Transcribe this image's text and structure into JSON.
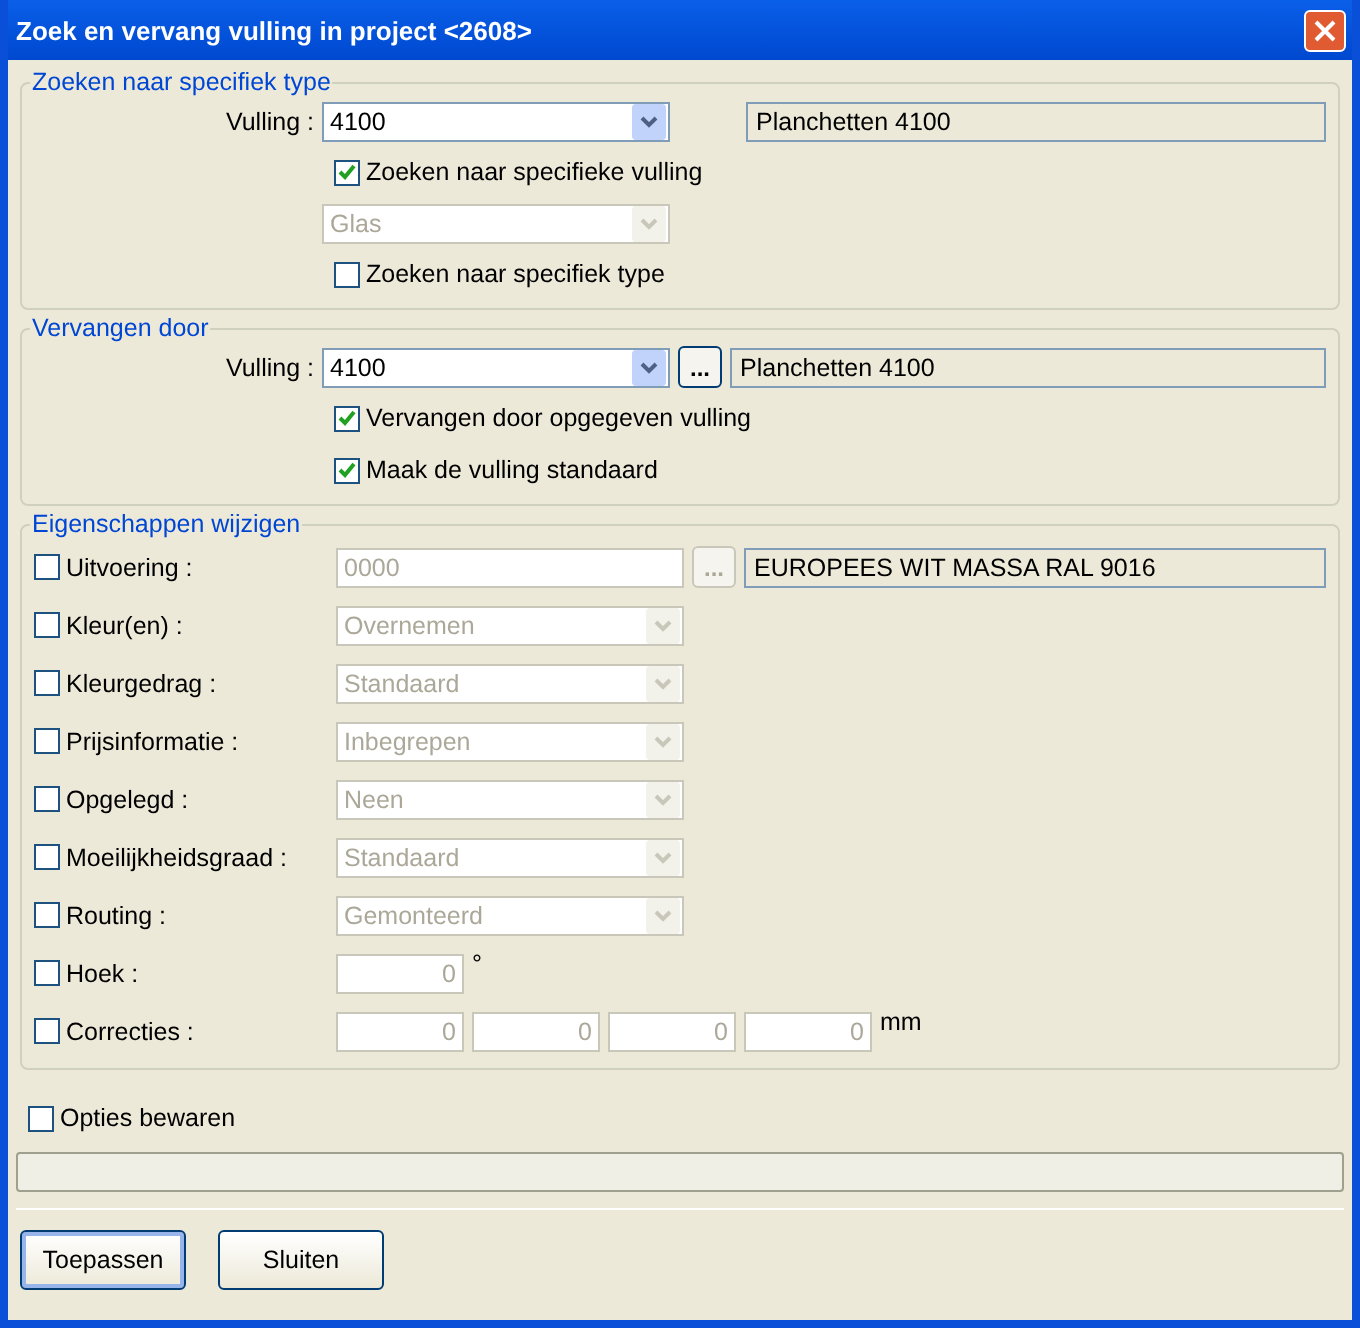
{
  "window": {
    "title": "Zoek en vervang vulling in project <2608>"
  },
  "search": {
    "legend": "Zoeken naar specifiek type",
    "label": "Vulling :",
    "value": "4100",
    "description": "Planchetten 4100",
    "specific_filling": {
      "label": "Zoeken naar specifieke vulling",
      "checked": true
    },
    "type_select": {
      "value": "Glas",
      "disabled": true
    },
    "specific_type": {
      "label": "Zoeken naar specifiek type",
      "checked": false
    }
  },
  "replace": {
    "legend": "Vervangen door",
    "label": "Vulling :",
    "value": "4100",
    "browse": "...",
    "description": "Planchetten 4100",
    "options": [
      {
        "label": "Vervangen door opgegeven vulling",
        "checked": true
      },
      {
        "label": "Maak de vulling standaard",
        "checked": true
      }
    ]
  },
  "properties": {
    "legend": "Eigenschappen wijzigen",
    "rows": [
      {
        "kind": "code",
        "label": "Uitvoering :",
        "checked": false,
        "disabled": true,
        "value": "0000",
        "browse": "...",
        "description": "EUROPEES WIT MASSA RAL 9016"
      },
      {
        "kind": "select",
        "label": "Kleur(en) :",
        "checked": false,
        "disabled": true,
        "value": "Overnemen"
      },
      {
        "kind": "select",
        "label": "Kleurgedrag :",
        "checked": false,
        "disabled": true,
        "value": "Standaard"
      },
      {
        "kind": "select",
        "label": "Prijsinformatie :",
        "checked": false,
        "disabled": true,
        "value": "Inbegrepen"
      },
      {
        "kind": "select",
        "label": "Opgelegd :",
        "checked": false,
        "disabled": true,
        "value": "Neen"
      },
      {
        "kind": "select",
        "label": "Moeilijkheidsgraad :",
        "checked": false,
        "disabled": true,
        "value": "Standaard"
      },
      {
        "kind": "select",
        "label": "Routing :",
        "checked": false,
        "disabled": true,
        "value": "Gemonteerd"
      },
      {
        "kind": "numbers",
        "label": "Hoek :",
        "checked": false,
        "disabled": true,
        "values": [
          "0"
        ],
        "unit": "°"
      },
      {
        "kind": "numbers",
        "label": "Correcties :",
        "checked": false,
        "disabled": true,
        "values": [
          "0",
          "0",
          "0",
          "0"
        ],
        "unit": "mm"
      }
    ]
  },
  "save_options": {
    "label": "Opties bewaren",
    "checked": false
  },
  "progress": {
    "level": 0
  },
  "buttons": [
    {
      "label": "Toepassen",
      "default": true
    },
    {
      "label": "Sluiten",
      "default": false
    }
  ]
}
